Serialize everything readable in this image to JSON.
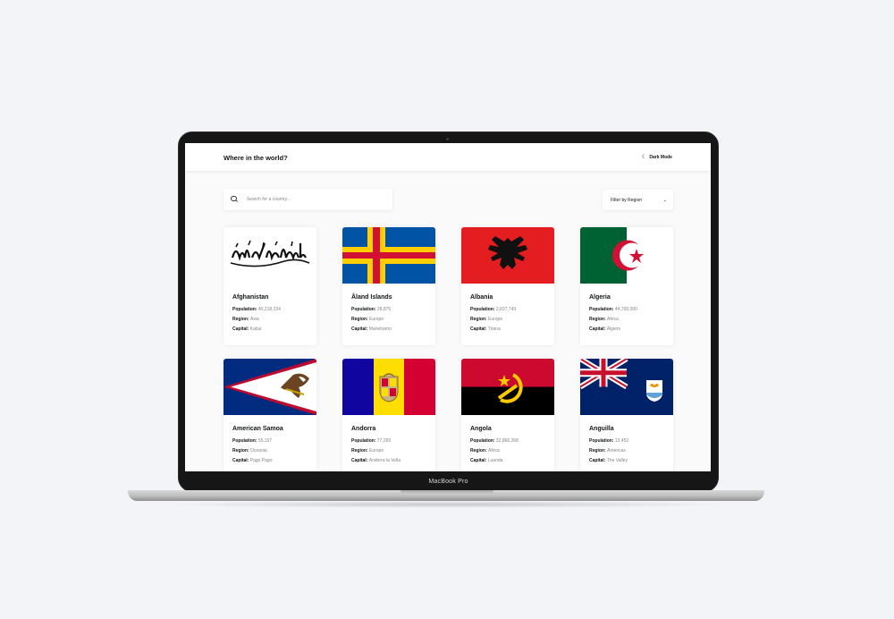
{
  "device": {
    "label": "MacBook Pro"
  },
  "header": {
    "title": "Where in the world?",
    "dark_mode_label": "Dark Mode"
  },
  "search": {
    "placeholder": "Search for a country..."
  },
  "filter": {
    "label": "Filter by Region"
  },
  "labels": {
    "population": "Population:",
    "region": "Region:",
    "capital": "Capital:"
  },
  "countries": [
    {
      "name": "Afghanistan",
      "population": "40,218,234",
      "region": "Asia",
      "capital": "Kabul"
    },
    {
      "name": "Åland Islands",
      "population": "28,875",
      "region": "Europe",
      "capital": "Mariehamn"
    },
    {
      "name": "Albania",
      "population": "2,837,743",
      "region": "Europe",
      "capital": "Tirana"
    },
    {
      "name": "Algeria",
      "population": "44,700,000",
      "region": "Africa",
      "capital": "Algiers"
    },
    {
      "name": "American Samoa",
      "population": "55,197",
      "region": "Oceania",
      "capital": "Pago Pago"
    },
    {
      "name": "Andorra",
      "population": "77,265",
      "region": "Europe",
      "capital": "Andorra la Vella"
    },
    {
      "name": "Angola",
      "population": "32,866,268",
      "region": "Africa",
      "capital": "Luanda"
    },
    {
      "name": "Anguilla",
      "population": "13,452",
      "region": "Americas",
      "capital": "The Valley"
    }
  ],
  "colors": {
    "background": "#fafafa",
    "text": "#111517",
    "muted": "#858585"
  }
}
